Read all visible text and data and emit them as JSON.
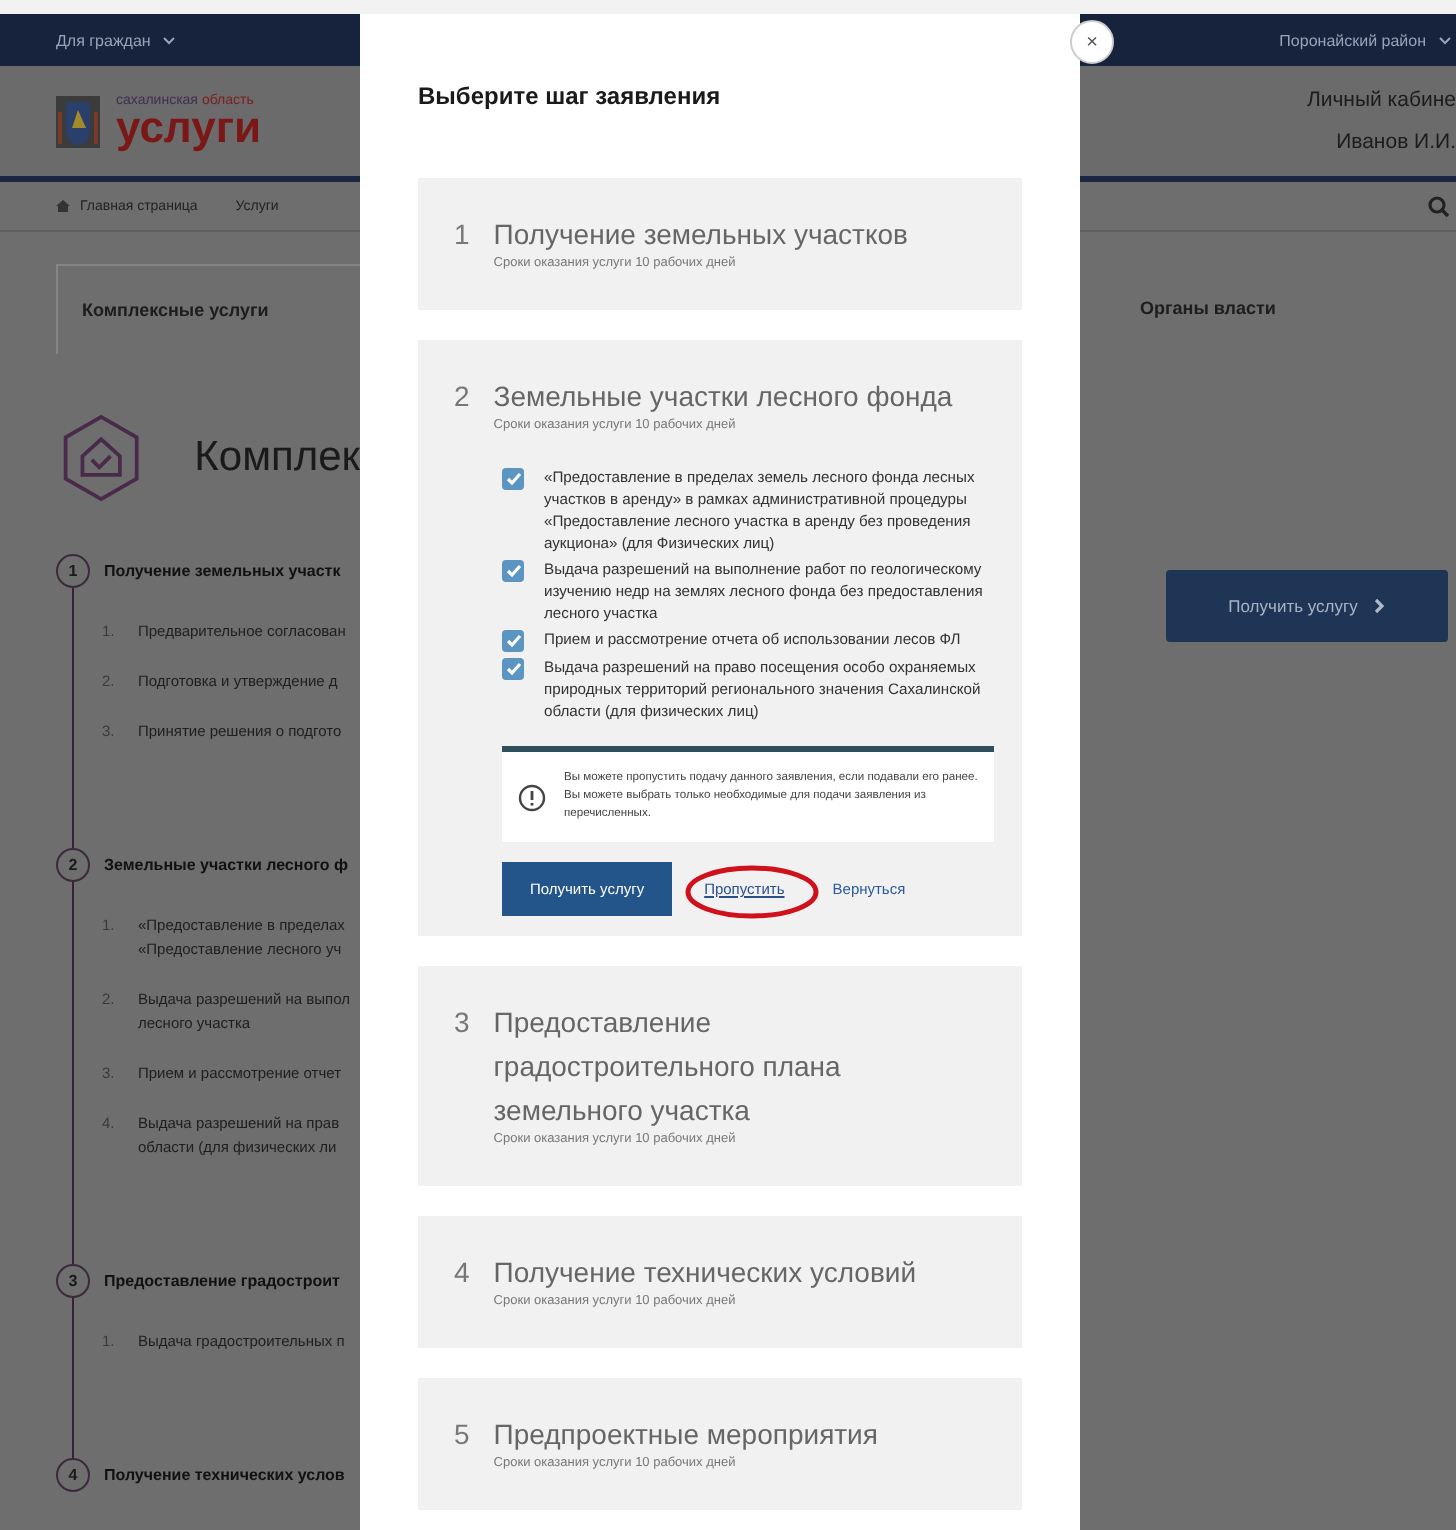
{
  "background_page": {
    "top_bar": {
      "audience_menu": "Для граждан",
      "district_menu": "Поронайский район"
    },
    "logo": {
      "region_word_1": "сахалинская",
      "region_word_2": "область",
      "title": "услуги"
    },
    "account": {
      "link": "Личный кабине",
      "user": "Иванов И.И."
    },
    "breadcrumbs": [
      "Главная страница",
      "Услуги"
    ],
    "tabs": [
      {
        "label": "Комплексные услуги",
        "selected": true
      },
      {
        "label": "Органы власти",
        "selected": false
      }
    ],
    "heading": "Комплек",
    "get_service_button": "Получить услугу",
    "steps": [
      {
        "number": "1",
        "title": "Получение земельных участк",
        "items": [
          {
            "number": "1.",
            "lines": [
              "Предварительное согласован"
            ]
          },
          {
            "number": "2.",
            "lines": [
              "Подготовка и утверждение д"
            ]
          },
          {
            "number": "3.",
            "lines": [
              "Принятие решения о подгото"
            ]
          }
        ]
      },
      {
        "number": "2",
        "title": "Земельные участки лесного ф",
        "items": [
          {
            "number": "1.",
            "lines": [
              "«Предоставление в пределах",
              "«Предоставление лесного уч"
            ]
          },
          {
            "number": "2.",
            "lines": [
              "Выдача разрешений на выпол",
              "лесного участка"
            ]
          },
          {
            "number": "3.",
            "lines": [
              "Прием и рассмотрение отчет"
            ]
          },
          {
            "number": "4.",
            "lines": [
              "Выдача разрешений на прав",
              "области (для физических ли"
            ]
          }
        ]
      },
      {
        "number": "3",
        "title": "Предоставление градостроит",
        "items": [
          {
            "number": "1.",
            "lines": [
              "Выдача градостроительных п"
            ]
          }
        ]
      },
      {
        "number": "4",
        "title": "Получение технических услов"
      }
    ]
  },
  "modal": {
    "close": "×",
    "title": "Выберите шаг заявления",
    "steps": [
      {
        "number": "1",
        "title": "Получение земельных участков",
        "term": "Сроки оказания услуги 10 рабочих дней",
        "expanded": false
      },
      {
        "number": "2",
        "title": "Земельные участки лесного фонда",
        "term": "Сроки оказания услуги 10 рабочих дней",
        "expanded": true,
        "options": [
          {
            "label": "«Предоставление в пределах земель лесного фонда лесных участков в аренду» в рамках административной процедуры «Предоставление лесного участка в аренду без проведения аукциона» (для Физических лиц)",
            "checked": true
          },
          {
            "label": "Выдача разрешений на выполнение работ по геологическому изучению недр на землях лесного фонда без предоставления лесного участка",
            "checked": true
          },
          {
            "label": "Прием и рассмотрение отчета об использовании лесов ФЛ",
            "checked": true
          },
          {
            "label": "Выдача разрешений на право посещения особо охраняемых природных территорий регионального значения Сахалинской области (для физических лиц)",
            "checked": true
          }
        ],
        "note": "Вы можете пропустить подачу данного заявления, если подавали его ранее. Вы можете выбрать только необходимые для подачи заявления из перечисленных.",
        "buttons": {
          "primary": "Получить услугу",
          "skip": {
            "label": "Пропустить",
            "circled": true
          },
          "back": "Вернуться"
        }
      },
      {
        "number": "3",
        "title": "Предоставление градостроительного плана земельного участка",
        "term": "Сроки оказания услуги 10 рабочих дней",
        "expanded": false
      },
      {
        "number": "4",
        "title": "Получение технических условий",
        "term": "Сроки оказания услуги 10 рабочих дней",
        "expanded": false
      },
      {
        "number": "5",
        "title": "Предпроектные мероприятия",
        "term": "Сроки оказания услуги 10 рабочих дней",
        "expanded": false
      }
    ]
  }
}
